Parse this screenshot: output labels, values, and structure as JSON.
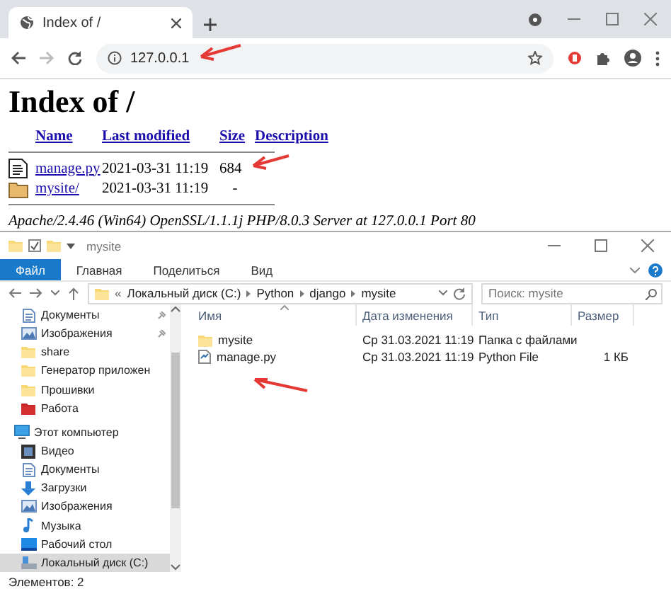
{
  "browser": {
    "tab": {
      "title": "Index of /"
    },
    "address": "127.0.0.1",
    "page": {
      "heading": "Index of /",
      "columns": [
        "Name",
        "Last modified",
        "Size",
        "Description"
      ],
      "rows": [
        {
          "kind": "file",
          "name": "manage.py",
          "modified": "2021-03-31 11:19",
          "size": "684"
        },
        {
          "kind": "folder",
          "name": "mysite/",
          "modified": "2021-03-31 11:19",
          "size": "-"
        }
      ],
      "footer": "Apache/2.4.46 (Win64) OpenSSL/1.1.1j PHP/8.0.3 Server at 127.0.0.1 Port 80"
    }
  },
  "explorer": {
    "window_title": "mysite",
    "ribbon_tabs": [
      {
        "label": "Файл",
        "selected": true
      },
      {
        "label": "Главная",
        "selected": false
      },
      {
        "label": "Поделиться",
        "selected": false
      },
      {
        "label": "Вид",
        "selected": false
      }
    ],
    "overflow_mark": "«",
    "breadcrumb": [
      "Локальный диск (C:)",
      "Python",
      "django",
      "mysite"
    ],
    "search": {
      "placeholder": "Поиск: mysite"
    },
    "nav": [
      {
        "label": "Документы",
        "kind": "docs",
        "pinned": true,
        "selected": false
      },
      {
        "label": "Изображения",
        "kind": "images",
        "pinned": true,
        "selected": false
      },
      {
        "label": "share",
        "kind": "folder",
        "pinned": false,
        "selected": false
      },
      {
        "label": "Генератор приложен",
        "kind": "folder",
        "pinned": false,
        "selected": false
      },
      {
        "label": "Прошивки",
        "kind": "folder",
        "pinned": false,
        "selected": false
      },
      {
        "label": "Работа",
        "kind": "red-folder",
        "pinned": false,
        "selected": false
      },
      {
        "label": "Этот компьютер",
        "kind": "pc",
        "pinned": false,
        "selected": false,
        "children": [
          {
            "label": "Видео",
            "kind": "video",
            "pinned": false,
            "selected": false
          },
          {
            "label": "Документы",
            "kind": "docs",
            "pinned": false,
            "selected": false
          },
          {
            "label": "Загрузки",
            "kind": "downloads",
            "pinned": false,
            "selected": false
          },
          {
            "label": "Изображения",
            "kind": "images",
            "pinned": false,
            "selected": false
          },
          {
            "label": "Музыка",
            "kind": "music",
            "pinned": false,
            "selected": false
          },
          {
            "label": "Рабочий стол",
            "kind": "desktop",
            "pinned": false,
            "selected": false
          },
          {
            "label": "Локальный диск (C:)",
            "kind": "drive",
            "pinned": false,
            "selected": true
          }
        ]
      }
    ],
    "columns": [
      "Имя",
      "Дата изменения",
      "Тип",
      "Размер"
    ],
    "rows": [
      {
        "kind": "folder",
        "name": "mysite",
        "modified": "Ср 31.03.2021 11:19",
        "type": "Папка с файлами"
      },
      {
        "kind": "file",
        "name": "manage.py",
        "modified": "Ср 31.03.2021 11:19",
        "type": "Python File",
        "size": "1 КБ"
      }
    ],
    "status": "Элементов: 2"
  }
}
